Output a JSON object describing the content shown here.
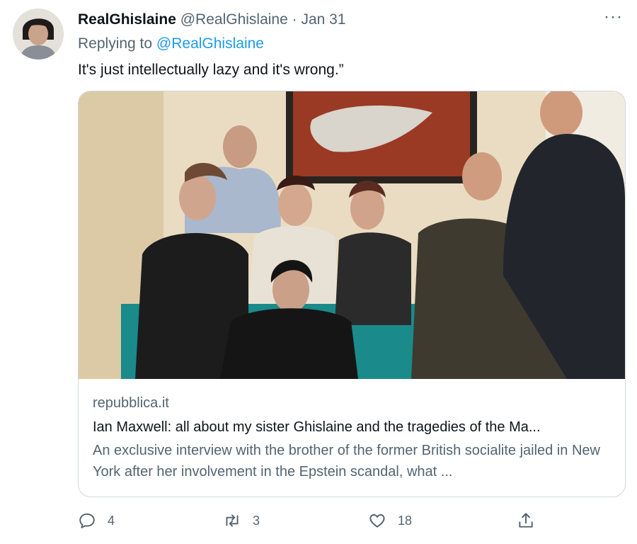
{
  "tweet": {
    "display_name": "RealGhislaine",
    "handle": "@RealGhislaine",
    "separator": "·",
    "date": "Jan 31",
    "replying_prefix": "Replying to",
    "replying_to": "@RealGhislaine",
    "text": "It's just intellectually lazy and it's wrong.”",
    "more_label": "···"
  },
  "card": {
    "domain": "repubblica.it",
    "title": "Ian Maxwell: all about my sister Ghislaine and the tragedies of the Ma...",
    "description": "An exclusive interview with the brother of the former British socialite jailed in New York after her involvement in the Epstein scandal, what ..."
  },
  "actions": {
    "reply_count": "4",
    "retweet_count": "3",
    "like_count": "18"
  },
  "icons": {
    "reply": "reply-icon",
    "retweet": "retweet-icon",
    "like": "heart-icon",
    "share": "share-icon",
    "more": "more-icon"
  },
  "colors": {
    "link_blue": "#1d9bf0",
    "secondary_text": "#536471",
    "border": "#cfd9de"
  }
}
